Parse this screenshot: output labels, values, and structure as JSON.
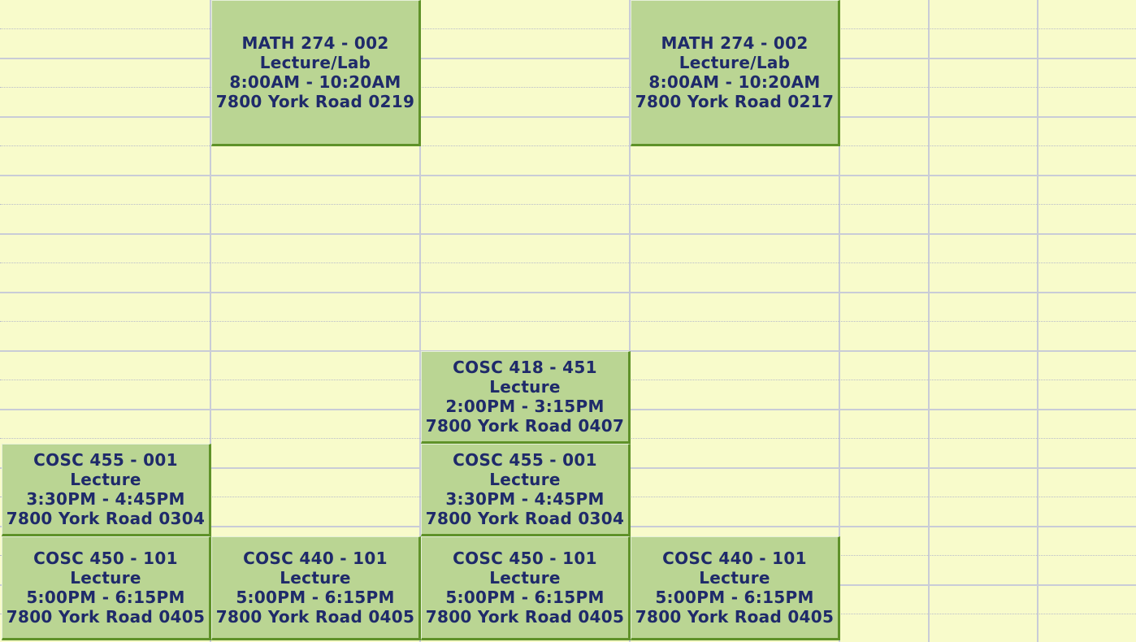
{
  "colors": {
    "background": "#f8fbcb",
    "event_fill": "#bad593",
    "event_border": "#5f9229",
    "event_text": "#1f2a6a",
    "grid_line": "#c9ccd7"
  },
  "events": [
    {
      "id": "math274-mon",
      "course": "MATH 274 - 002",
      "type": "Lecture/Lab",
      "time": "8:00AM - 10:20AM",
      "location": "7800 York Road 0219"
    },
    {
      "id": "math274-wed",
      "course": "MATH 274 - 002",
      "type": "Lecture/Lab",
      "time": "8:00AM - 10:20AM",
      "location": "7800 York Road 0217"
    },
    {
      "id": "cosc418-tue",
      "course": "COSC 418 - 451",
      "type": "Lecture",
      "time": "2:00PM - 3:15PM",
      "location": "7800 York Road 0407"
    },
    {
      "id": "cosc455-sun",
      "course": "COSC 455 - 001",
      "type": "Lecture",
      "time": "3:30PM - 4:45PM",
      "location": "7800 York Road 0304"
    },
    {
      "id": "cosc455-tue",
      "course": "COSC 455 - 001",
      "type": "Lecture",
      "time": "3:30PM - 4:45PM",
      "location": "7800 York Road 0304"
    },
    {
      "id": "cosc450-sun",
      "course": "COSC 450 - 101",
      "type": "Lecture",
      "time": "5:00PM - 6:15PM",
      "location": "7800 York Road 0405"
    },
    {
      "id": "cosc440-mon",
      "course": "COSC 440 - 101",
      "type": "Lecture",
      "time": "5:00PM - 6:15PM",
      "location": "7800 York Road 0405"
    },
    {
      "id": "cosc450-tue",
      "course": "COSC 450 - 101",
      "type": "Lecture",
      "time": "5:00PM - 6:15PM",
      "location": "7800 York Road 0405"
    },
    {
      "id": "cosc440-wed",
      "course": "COSC 440 - 101",
      "type": "Lecture",
      "time": "5:00PM - 6:15PM",
      "location": "7800 York Road 0405"
    }
  ]
}
